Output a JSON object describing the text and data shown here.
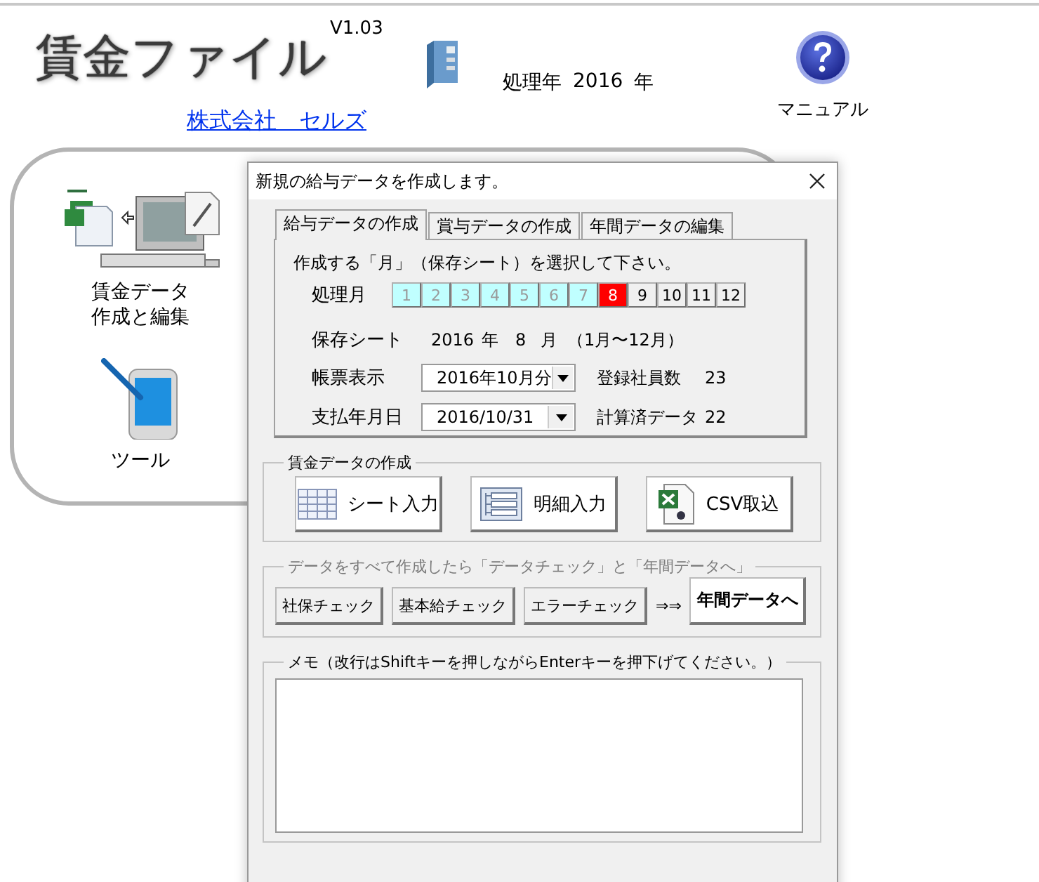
{
  "app": {
    "title": "賃金ファイル",
    "version": "V1.03",
    "company_link": "株式会社　セルズ",
    "year_label": "処理年",
    "year": "2016",
    "year_unit": "年",
    "manual": "マニュアル"
  },
  "menu": [
    {
      "lines": [
        "賃金データ",
        "作成と編集"
      ],
      "kind": "computer"
    },
    {
      "lines": [
        "ツール"
      ],
      "kind": "tablet"
    }
  ],
  "dialog": {
    "title": "新規の給与データを作成します。",
    "tabs": [
      {
        "label": "給与データの作成",
        "selected": true
      },
      {
        "label": "賞与データの作成",
        "selected": false
      },
      {
        "label": "年間データの編集",
        "selected": false
      }
    ],
    "instruction": "作成する「月」（保存シート）を選択して下さい。",
    "month_label": "処理月",
    "months": [
      {
        "label": "1",
        "done": true,
        "selected": false
      },
      {
        "label": "2",
        "done": true,
        "selected": false
      },
      {
        "label": "3",
        "done": true,
        "selected": false
      },
      {
        "label": "4",
        "done": true,
        "selected": false
      },
      {
        "label": "5",
        "done": true,
        "selected": false
      },
      {
        "label": "6",
        "done": true,
        "selected": false
      },
      {
        "label": "7",
        "done": true,
        "selected": false
      },
      {
        "label": "8",
        "done": false,
        "selected": true
      },
      {
        "label": "9",
        "done": false,
        "selected": false
      },
      {
        "label": "10",
        "done": false,
        "selected": false
      },
      {
        "label": "11",
        "done": false,
        "selected": false
      },
      {
        "label": "12",
        "done": false,
        "selected": false
      }
    ],
    "sheet": {
      "label": "保存シート",
      "year": "2016",
      "year_unit": "年",
      "month": "8",
      "month_unit": "月",
      "range": "（1月〜12月）"
    },
    "fields": [
      {
        "label": "帳票表示",
        "value": "2016年10月分",
        "stat_label": "登録社員数",
        "stat_value": "23"
      },
      {
        "label": "支払年月日",
        "value": "2016/10/31",
        "stat_label": "計算済データ",
        "stat_value": "22"
      }
    ],
    "create_group": {
      "legend": "賃金データの作成",
      "buttons": [
        {
          "label": "シート入力",
          "kind": "grid"
        },
        {
          "label": "明細入力",
          "kind": "list"
        },
        {
          "label": "CSV取込",
          "kind": "csv"
        }
      ]
    },
    "check_group": {
      "legend": "データをすべて作成したら「データチェック」と「年間データへ」",
      "buttons": [
        "社保チェック",
        "基本給チェック",
        "エラーチェック"
      ],
      "arrow": "⇒⇒",
      "next_button": "年間データへ"
    },
    "memo": {
      "legend": "メモ（改行はShiftキーを押しながらEnterキーを押下げてください。）"
    }
  }
}
